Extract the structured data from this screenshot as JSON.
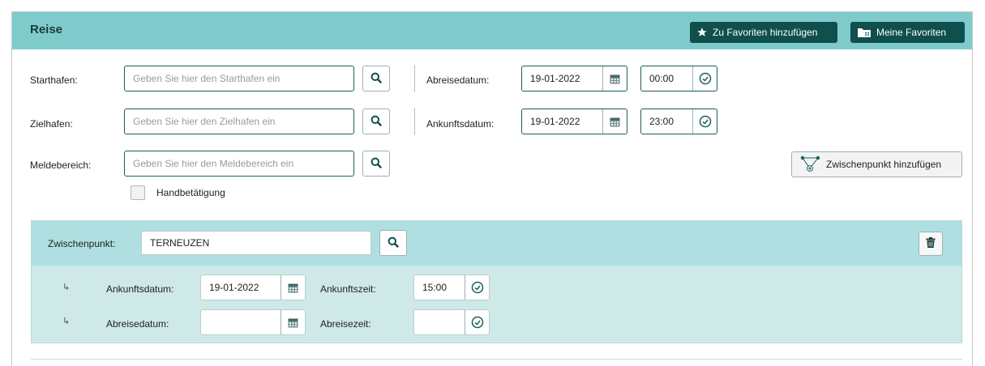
{
  "header": {
    "title": "Reise",
    "add_favorite_label": "Zu Favoriten hinzufügen",
    "my_favorites_label": "Meine Favoriten"
  },
  "form": {
    "start_port": {
      "label": "Starthafen:",
      "placeholder": "Geben Sie hier den Starthafen ein"
    },
    "destination_port": {
      "label": "Zielhafen:",
      "placeholder": "Geben Sie hier den Zielhafen ein"
    },
    "report_area": {
      "label": "Meldebereich:",
      "placeholder": "Geben Sie hier den Meldebereich ein"
    },
    "departure_date": {
      "label": "Abreisedatum:",
      "value": "19-01-2022",
      "time": "00:00"
    },
    "arrival_date": {
      "label": "Ankunftsdatum:",
      "value": "19-01-2022",
      "time": "23:00"
    },
    "manual_operation_label": "Handbetätigung",
    "add_waypoint_label": "Zwischenpunkt hinzufügen"
  },
  "waypoint": {
    "label": "Zwischenpunkt:",
    "value": "TERNEUZEN",
    "arrival_date_label": "Ankunftsdatum:",
    "arrival_date_value": "19-01-2022",
    "arrival_time_label": "Ankunftszeit:",
    "arrival_time_value": "15:00",
    "departure_date_label": "Abreisedatum:",
    "departure_date_value": "",
    "departure_time_label": "Abreisezeit:",
    "departure_time_value": ""
  },
  "icons": {
    "favorite": "star-icon",
    "favorites_folder": "folder-icon",
    "search": "search-icon",
    "calendar": "calendar-icon",
    "clock": "clock-icon",
    "waypoint": "waypoint-network-icon",
    "delete": "trash-icon",
    "sub_arrow": "sub-arrow-icon"
  },
  "colors": {
    "header_bg": "#7fcbcc",
    "button_dark": "#0f4f4d",
    "waypoint_bg": "#cfe8e8",
    "waypoint_header_bg": "#afdfe0"
  }
}
